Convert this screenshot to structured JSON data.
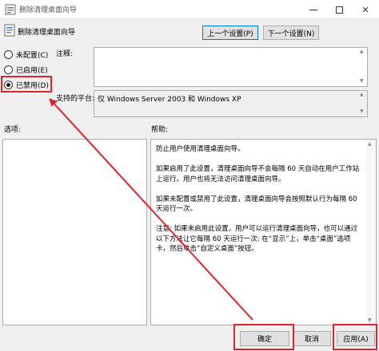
{
  "window": {
    "title": "删除清理桌面向导",
    "title_icon": "policy-settings-icon",
    "controls": {
      "minimize_icon": "minimize-icon",
      "maximize_icon": "maximize-icon",
      "close_icon": "close-icon",
      "close_glyph": "✕"
    }
  },
  "header": {
    "policy_name": "删除清理桌面向导",
    "policy_icon": "policy-settings-icon",
    "prev_label": "上一个设置(P)",
    "next_label": "下一个设置(N)"
  },
  "state_options": [
    {
      "label": "未配置(C)",
      "selected": false
    },
    {
      "label": "已启用(E)",
      "selected": false
    },
    {
      "label": "已禁用(D)",
      "selected": true
    }
  ],
  "comment": {
    "label": "注释:",
    "value": ""
  },
  "supported": {
    "label": "支持的平台:",
    "value": "仅 Windows Server 2003 和 Windows XP"
  },
  "options": {
    "label": "选项:"
  },
  "help": {
    "label": "帮助:",
    "paragraphs": [
      "防止用户使用清理桌面向导。",
      "如果启用了此设置，清理桌面向导不会每隔 60 天自动在用户工作站上运行。用户也将无法访问清理桌面向导。",
      "如果未配置或禁用了此设置，清理桌面向导会按照默认行为每隔 60 天运行一次。",
      "注意: 如果未启用此设置，用户可以运行清理桌面向导，也可以通过以下方法让它每隔 60 天运行一次: 在“显示”上，单击“桌面”选项卡，然后单击“自定义桌面”按钮。"
    ]
  },
  "footer": {
    "ok_label": "确定",
    "cancel_label": "取消",
    "apply_label": "应用(A)"
  },
  "annotation_color": "#e0242d"
}
